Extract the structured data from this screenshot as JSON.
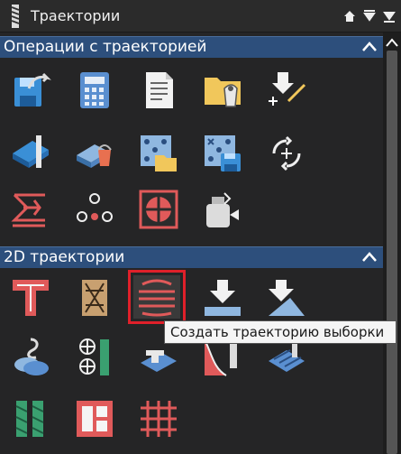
{
  "window": {
    "title": "Траектории"
  },
  "sections": {
    "operations": {
      "title": "Операции с траекторией"
    },
    "paths2d": {
      "title": "2D траектории"
    }
  },
  "tooltip": {
    "text": "Создать траекторию выборки"
  },
  "colors": {
    "section_bg": "#2d4f7c",
    "panel_bg": "#252526",
    "highlight": "#e0202a",
    "tooltip_bg": "#f5f5f5"
  },
  "icons": {
    "operations": [
      "save-toolpath-icon",
      "calculator-icon",
      "document-icon",
      "folder-info-icon",
      "import-toolpath-icon",
      "material-block-icon",
      "material-bucket-icon",
      "toolpath-folder-icon",
      "save-grid-icon",
      "rotate-move-icon",
      "merge-toolpaths-icon",
      "node-circle-icon",
      "tiling-icon",
      "post-processor-icon"
    ],
    "paths2d": [
      "profile-t-icon",
      "vcarve-pattern-icon",
      "pocket-toolpath-icon",
      "drilling-down-icon",
      "chamfer-icon",
      "inlay-icon",
      "drilling-circles-icon",
      "texture-toolpath-icon",
      "moulding-icon",
      "fluting-icon",
      "spiral-flute-icon",
      "frame-icon",
      "grid-pattern-icon"
    ]
  }
}
